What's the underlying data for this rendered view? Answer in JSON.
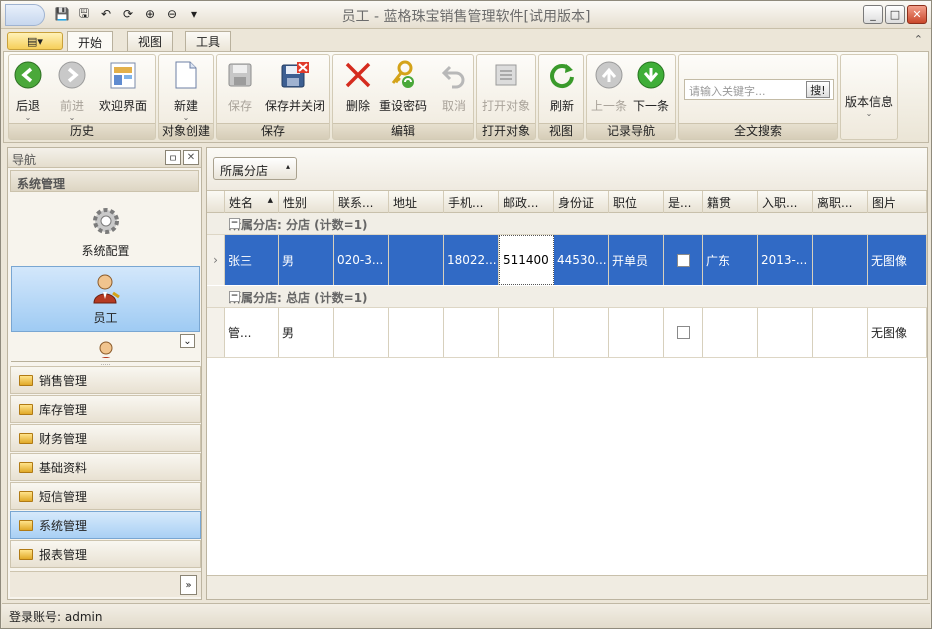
{
  "window": {
    "title": "员工 - 蓝格珠宝销售管理软件[试用版本]",
    "minimize": "_",
    "maximize": "□",
    "close": "✕"
  },
  "qat": [
    "💾",
    "🖫",
    "↶",
    "⟳",
    "⊕",
    "⊖",
    "▾"
  ],
  "tabs": {
    "file": "▤▾",
    "items": [
      "开始",
      "视图",
      "工具"
    ],
    "collapse": "⌃"
  },
  "ribbon": {
    "groups": {
      "history": "历史",
      "create": "对象创建",
      "save": "保存",
      "edit": "编辑",
      "open": "打开对象",
      "view": "视图",
      "nav": "记录导航",
      "search": "全文搜索"
    },
    "buttons": {
      "back": "后退",
      "forward": "前进",
      "welcome": "欢迎界面",
      "new": "新建",
      "save": "保存",
      "save_close": "保存并关闭",
      "delete": "删除",
      "reset_pwd": "重设密码",
      "cancel": "取消",
      "open_obj": "打开对象",
      "refresh": "刷新",
      "prev": "上一条",
      "next": "下一条",
      "version": "版本信息"
    },
    "search_placeholder": "请输入关键字...",
    "search_btn": "搜!"
  },
  "nav": {
    "title": "导航",
    "pin": "ㅁ",
    "close": "✕",
    "section": "系统管理",
    "big_items": [
      "系统配置",
      "员工"
    ],
    "more_btn": "⌄",
    "categories": [
      "销售管理",
      "库存管理",
      "财务管理",
      "基础资料",
      "短信管理",
      "系统管理",
      "报表管理"
    ],
    "footer_btn": "»"
  },
  "grid": {
    "groupby": "所属分店",
    "groupby_arrow": "▴",
    "columns": [
      "姓名",
      "性别",
      "联系...",
      "地址",
      "手机...",
      "邮政...",
      "身份证",
      "职位",
      "是...",
      "籍贯",
      "入职...",
      "离职...",
      "图片"
    ],
    "sort_icon": "▲",
    "groups": [
      {
        "label": "所属分店: 分店 (计数=1)",
        "rows": [
          [
            "张三",
            "男",
            "020-3...",
            "",
            "18022...",
            "511400",
            "44530...",
            "开单员",
            "",
            "广东",
            "2013-...",
            "",
            "无图像"
          ]
        ]
      },
      {
        "label": "所属分店: 总店 (计数=1)",
        "rows": [
          [
            "管...",
            "男",
            "",
            "",
            "",
            "",
            "",
            "",
            "",
            "",
            "",
            "",
            "无图像"
          ]
        ]
      }
    ],
    "row_indicator": "›",
    "minus": "−"
  },
  "status": {
    "login": "登录账号: admin"
  }
}
